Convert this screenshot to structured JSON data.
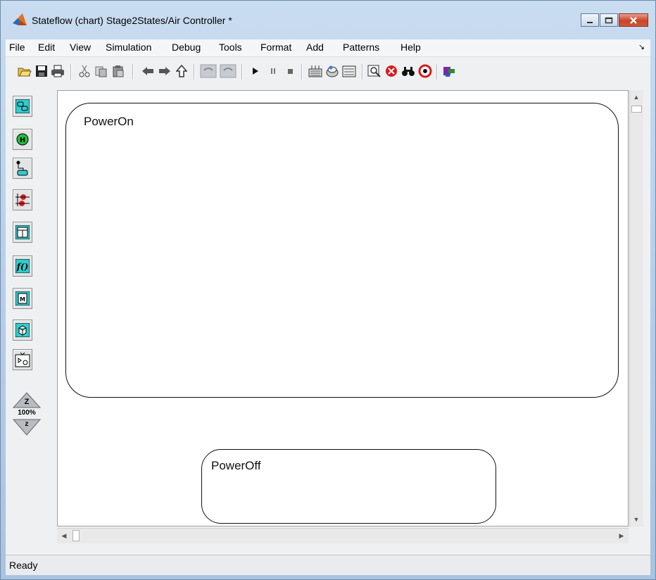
{
  "window": {
    "title": "Stateflow (chart) Stage2States/Air Controller *",
    "controls": [
      "minimize",
      "maximize",
      "close"
    ]
  },
  "menu": [
    "File",
    "Edit",
    "View",
    "Simulation",
    "Debug",
    "Tools",
    "Format",
    "Add",
    "Patterns",
    "Help"
  ],
  "toolbar": {
    "icons": [
      "open-icon",
      "save-icon",
      "print-icon",
      "cut-icon",
      "copy-icon",
      "paste-icon",
      "back-icon",
      "forward-icon",
      "up-icon",
      "undo-icon",
      "redo-icon",
      "play-icon",
      "pause-icon",
      "stop-icon",
      "build-icon",
      "incremental-build-icon",
      "rebuild-icon",
      "explorer-icon",
      "debugger-icon",
      "find-icon",
      "target-icon",
      "model-icon"
    ]
  },
  "palette": {
    "tools": [
      "state-tool-icon",
      "history-junction-icon",
      "default-transition-icon",
      "connective-junction-icon",
      "truth-table-icon",
      "graphical-function-icon",
      "matlab-function-icon",
      "box-tool-icon",
      "simulink-function-icon"
    ],
    "zoom_label": "100%",
    "zoom_in_text": "Z",
    "zoom_out_text": "z"
  },
  "states": [
    {
      "name": "PowerOn"
    },
    {
      "name": "PowerOff"
    }
  ],
  "status": "Ready",
  "colors": {
    "title_gradient": "#b8cfe8",
    "close_button": "#c9442a",
    "palette_icon_bg": "#33cccc"
  }
}
